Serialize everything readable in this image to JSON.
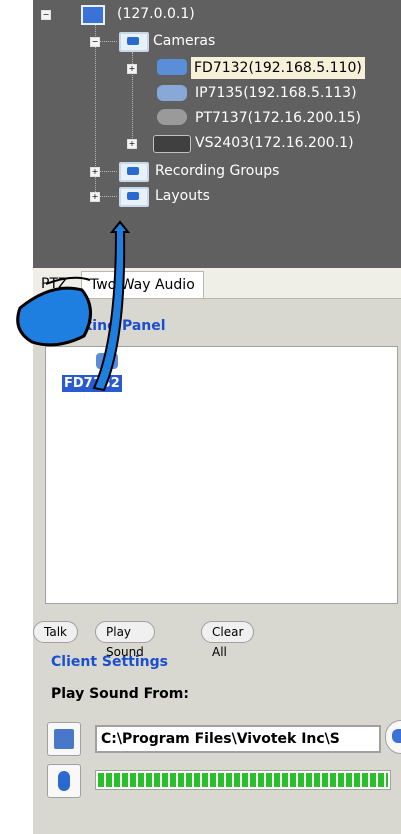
{
  "tree": {
    "server_label": "(127.0.0.1)",
    "cameras_label": "Cameras",
    "devices": [
      {
        "label": "FD7132(192.168.5.110)"
      },
      {
        "label": "IP7135(192.168.5.113)"
      },
      {
        "label": "PT7137(172.16.200.15)"
      },
      {
        "label": "VS2403(172.16.200.1)"
      }
    ],
    "recording_groups_label": "Recording Groups",
    "layouts_label": "Layouts"
  },
  "tabs": {
    "ptz_label": "PTZ",
    "two_way_audio_label": "Two Way Audio"
  },
  "talking_panel": {
    "title": "Talking Panel",
    "device_label": "FD7132"
  },
  "buttons": {
    "talk": "Talk",
    "play_sound": "Play Sound",
    "clear_all": "Clear All"
  },
  "client_settings": {
    "title": "Client Settings",
    "play_sound_from_label": "Play Sound From:",
    "path_value": "C:\\Program Files\\Vivotek Inc\\S",
    "volume_level": 1.0
  },
  "colors": {
    "tree_bg": "#606060",
    "accent_blue": "#1a4fd0",
    "meter_green": "#28c028"
  }
}
